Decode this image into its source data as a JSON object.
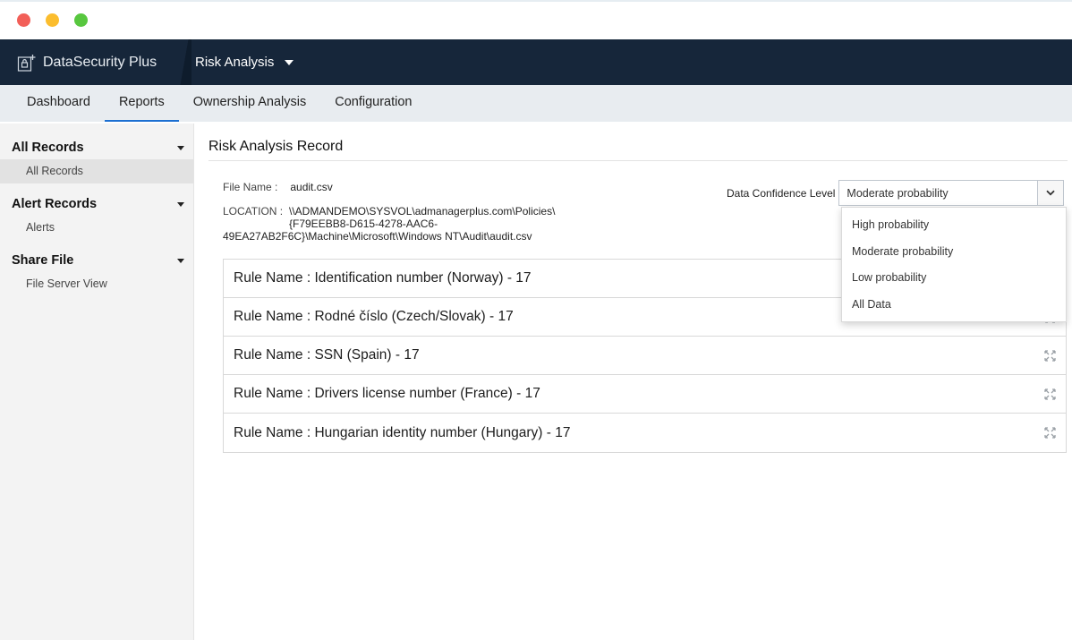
{
  "app": {
    "brand": "DataSecurity Plus",
    "module": "Risk Analysis"
  },
  "tabs": [
    {
      "label": "Dashboard"
    },
    {
      "label": "Reports"
    },
    {
      "label": "Ownership Analysis"
    },
    {
      "label": "Configuration"
    }
  ],
  "sidebar": {
    "groups": [
      {
        "title": "All Records",
        "items": [
          "All Records"
        ]
      },
      {
        "title": "Alert Records",
        "items": [
          "Alerts"
        ]
      },
      {
        "title": "Share File",
        "items": [
          "File Server View"
        ]
      }
    ]
  },
  "main": {
    "title": "Risk Analysis Record",
    "file_name_label": "File Name :",
    "file_name": "audit.csv",
    "location_label": "LOCATION :",
    "location_line1": "\\\\ADMANDEMO\\SYSVOL\\admanagerplus.com\\Policies\\",
    "location_line2": "{F79EEBB8-D615-4278-AAC6-",
    "location_line3": "49EA27AB2F6C}\\Machine\\Microsoft\\Windows NT\\Audit\\audit.csv",
    "confidence_label": "Data Confidence Level",
    "confidence_value": "Moderate probability",
    "confidence_options": [
      "High probability",
      "Moderate probability",
      "Low probability",
      "All Data"
    ],
    "rules": [
      "Rule Name : Identification number (Norway) - 17",
      "Rule Name : Rodné číslo (Czech/Slovak) - 17",
      "Rule Name : SSN (Spain) - 17",
      "Rule Name : Drivers license number (France) - 17",
      "Rule Name : Hungarian identity number (Hungary) - 17"
    ]
  },
  "colors": {
    "header_bg": "#16263a",
    "tab_active": "#1c6fd1",
    "sidebar_bg": "#f3f3f3"
  }
}
